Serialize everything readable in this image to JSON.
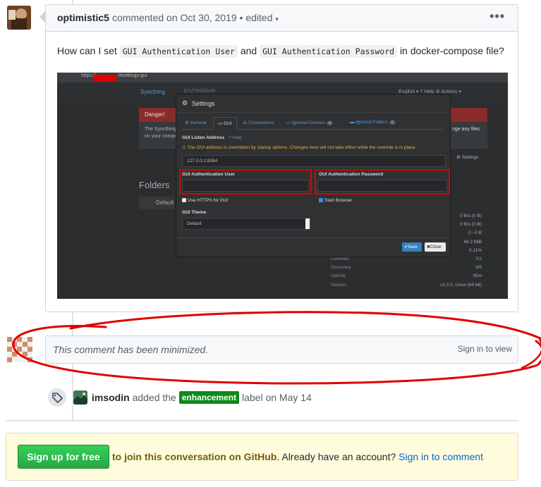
{
  "comment": {
    "author": "optimistic5",
    "meta_text": "commented on Oct 30, 2019 • edited",
    "menu_glyph": "•••",
    "body_prefix": "How can I set",
    "code1": "GUI Authentication User",
    "body_and": "and",
    "code2": "GUI Authentication Password",
    "body_suffix": "in docker-compose file?"
  },
  "screenshot": {
    "url_prefix": "https://",
    "url_path": "/#settings-gui",
    "brand": "Syncthing",
    "device_id": "b7cf78d42b45",
    "nav_right": "English ▾   ? Help   ⚙ Actions ▾",
    "danger_title": "Danger!",
    "danger_text_line1": "The Syncthing",
    "danger_text_line2": "on your compu",
    "danger_right": "nge any files",
    "folders_title": "Folders",
    "default_folder": "Default",
    "settings_btn": "⚙ Settings",
    "modal": {
      "title": "Settings",
      "tabs": [
        {
          "label": "⚙ General"
        },
        {
          "label": "GUI"
        },
        {
          "label": "Connections"
        },
        {
          "label": "Ignored Devices"
        },
        {
          "label": "Ignored Folders"
        }
      ],
      "badge_devices": "0",
      "badge_folders": "0",
      "listen_label": "GUI Listen Address",
      "help_label": "Help",
      "warning": "The GUI address is overridden by startup options. Changes here will not take effect while the override is in place.",
      "listen_value": "127.0.0.1:8384",
      "user_label": "GUI Authentication User",
      "password_label": "GUI Authentication Password",
      "https_label": "Use HTTPS for GUI",
      "browser_label": "Start Browser",
      "theme_label": "GUI Theme",
      "theme_value": "Default",
      "save_label": "Save",
      "close_label": "Close"
    },
    "stats": [
      {
        "label": "",
        "value": "0 B/s (0 B)"
      },
      {
        "label": "",
        "value": "0 B/s (0 B)"
      },
      {
        "label": "",
        "value": "0  ~0 B"
      },
      {
        "label": "",
        "value": "48.2 MiB"
      },
      {
        "label": "",
        "value": "0.11%"
      },
      {
        "label": "Listeners",
        "value": "3/3"
      },
      {
        "label": "Discovery",
        "value": "3/5"
      },
      {
        "label": "Uptime",
        "value": "35m"
      },
      {
        "label": "Version",
        "value": "v1.3.0, Linux (64 bit)"
      }
    ]
  },
  "minimized": {
    "text": "This comment has been minimized.",
    "link": "Sign in to view"
  },
  "event": {
    "actor": "imsodin",
    "action": "added the",
    "label": "enhancement",
    "suffix": "label on May 14",
    "label_color": "#0e8a16"
  },
  "signup": {
    "button": "Sign up for free",
    "strong_text": "to join this conversation on GitHub",
    "middle_text": ". Already have an account?",
    "link": "Sign in to comment"
  },
  "colors": {
    "link": "#0366d6",
    "green": "#28a745",
    "annotation_red": "#e00000"
  }
}
